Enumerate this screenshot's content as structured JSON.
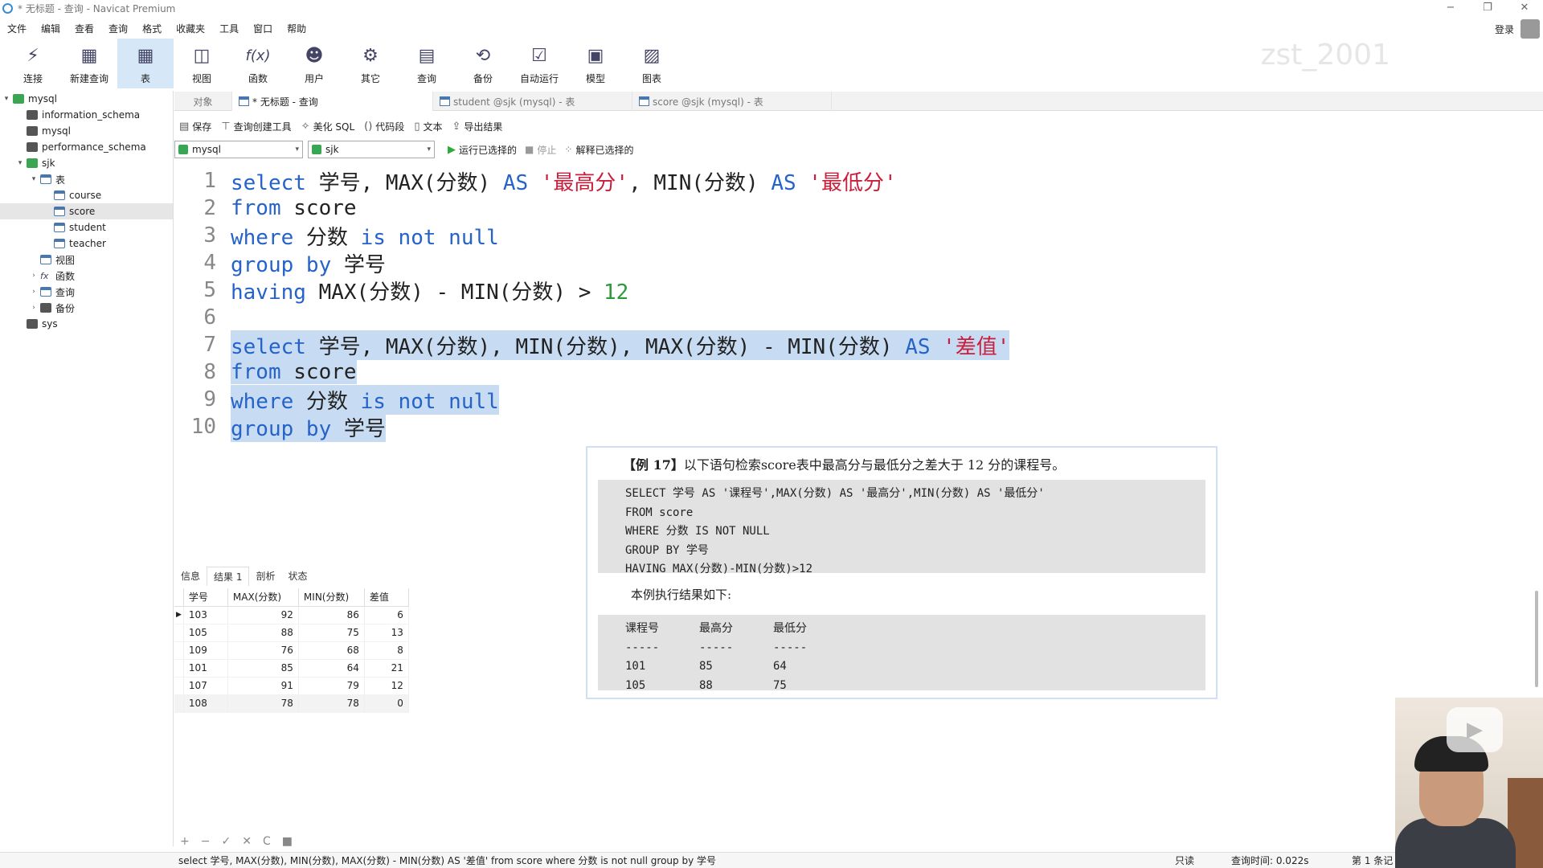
{
  "window": {
    "title": "* 无标题 - 查询 - Navicat Premium",
    "controls": [
      "−",
      "❐",
      "✕"
    ]
  },
  "menu": [
    "文件",
    "编辑",
    "查看",
    "查询",
    "格式",
    "收藏夹",
    "工具",
    "窗口",
    "帮助"
  ],
  "toolbar": {
    "buttons": [
      {
        "label": "连接",
        "icon": "plug-icon"
      },
      {
        "label": "新建查询",
        "icon": "new-query-icon"
      },
      {
        "label": "表",
        "icon": "table-icon",
        "active": true
      },
      {
        "label": "视图",
        "icon": "view-icon"
      },
      {
        "label": "函数",
        "icon": "function-icon",
        "glyph": "f(x)"
      },
      {
        "label": "用户",
        "icon": "user-icon"
      },
      {
        "label": "其它",
        "icon": "other-icon"
      },
      {
        "label": "查询",
        "icon": "query-icon"
      },
      {
        "label": "备份",
        "icon": "backup-icon"
      },
      {
        "label": "自动运行",
        "icon": "autorun-icon"
      },
      {
        "label": "模型",
        "icon": "model-icon"
      },
      {
        "label": "图表",
        "icon": "chart-icon"
      }
    ],
    "login": "登录",
    "watermark": "zst_2001"
  },
  "sidebar": {
    "items": [
      {
        "label": "mysql",
        "level": 0,
        "arrow": "▾",
        "icon": "connection-icon"
      },
      {
        "label": "information_schema",
        "level": 1,
        "arrow": "",
        "icon": "database-icon"
      },
      {
        "label": "mysql",
        "level": 1,
        "arrow": "",
        "icon": "database-icon"
      },
      {
        "label": "performance_schema",
        "level": 1,
        "arrow": "",
        "icon": "database-icon"
      },
      {
        "label": "sjk",
        "level": 1,
        "arrow": "▾",
        "icon": "database-open-icon"
      },
      {
        "label": "表",
        "level": 2,
        "arrow": "▾",
        "icon": "tables-folder-icon"
      },
      {
        "label": "course",
        "level": 3,
        "arrow": "",
        "icon": "table-icon"
      },
      {
        "label": "score",
        "level": 3,
        "arrow": "",
        "icon": "table-icon",
        "selected": true
      },
      {
        "label": "student",
        "level": 3,
        "arrow": "",
        "icon": "table-icon"
      },
      {
        "label": "teacher",
        "level": 3,
        "arrow": "",
        "icon": "table-icon"
      },
      {
        "label": "视图",
        "level": 2,
        "arrow": "",
        "icon": "view-icon"
      },
      {
        "label": "函数",
        "level": 2,
        "arrow": "›",
        "icon": "function-icon"
      },
      {
        "label": "查询",
        "level": 2,
        "arrow": "›",
        "icon": "query-icon"
      },
      {
        "label": "备份",
        "level": 2,
        "arrow": "›",
        "icon": "backup-icon"
      },
      {
        "label": "sys",
        "level": 1,
        "arrow": "",
        "icon": "database-icon"
      }
    ]
  },
  "tabs": [
    {
      "label": "对象",
      "active": false,
      "icon": false
    },
    {
      "label": "* 无标题 - 查询",
      "active": true,
      "icon": true
    },
    {
      "label": "student @sjk (mysql) - 表",
      "active": false,
      "icon": true
    },
    {
      "label": "score @sjk (mysql) - 表",
      "active": false,
      "icon": true
    }
  ],
  "query_toolbar": [
    {
      "label": "保存",
      "icon": "save-icon",
      "glyph": "▤"
    },
    {
      "label": "查询创建工具",
      "icon": "query-builder-icon",
      "glyph": "⊤"
    },
    {
      "label": "美化 SQL",
      "icon": "beautify-icon",
      "glyph": "✧"
    },
    {
      "label": "代码段",
      "icon": "snippet-icon",
      "glyph": "()"
    },
    {
      "label": "文本",
      "icon": "text-icon",
      "glyph": "▯"
    },
    {
      "label": "导出结果",
      "icon": "export-icon",
      "glyph": "⇪"
    }
  ],
  "selects": {
    "connection": "mysql",
    "database": "sjk",
    "run_selected": "运行已选择的",
    "stop": "停止",
    "explain": "解释已选择的"
  },
  "editor": {
    "lines": [
      {
        "n": "1",
        "hl": false,
        "tokens": [
          [
            "kw",
            "select"
          ],
          [
            "plain",
            " 学号, MAX(分数) "
          ],
          [
            "kw",
            "AS"
          ],
          [
            "plain",
            " "
          ],
          [
            "str",
            "'最高分'"
          ],
          [
            "plain",
            ", MIN(分数) "
          ],
          [
            "kw",
            "AS"
          ],
          [
            "plain",
            " "
          ],
          [
            "str",
            "'最低分'"
          ]
        ]
      },
      {
        "n": "2",
        "hl": false,
        "tokens": [
          [
            "kw",
            "from"
          ],
          [
            "plain",
            " score"
          ]
        ]
      },
      {
        "n": "3",
        "hl": false,
        "tokens": [
          [
            "kw",
            "where"
          ],
          [
            "plain",
            " 分数 "
          ],
          [
            "kw",
            "is not null"
          ]
        ]
      },
      {
        "n": "4",
        "hl": false,
        "tokens": [
          [
            "kw",
            "group by"
          ],
          [
            "plain",
            " 学号"
          ]
        ]
      },
      {
        "n": "5",
        "hl": false,
        "tokens": [
          [
            "kw",
            "having"
          ],
          [
            "plain",
            " MAX(分数) - MIN(分数) > "
          ],
          [
            "num",
            "12"
          ]
        ]
      },
      {
        "n": "6",
        "hl": false,
        "tokens": []
      },
      {
        "n": "7",
        "hl": true,
        "tokens": [
          [
            "kw",
            "select"
          ],
          [
            "plain",
            " 学号, MAX(分数), MIN(分数), MAX(分数) - MIN(分数) "
          ],
          [
            "kw",
            "AS"
          ],
          [
            "plain",
            " "
          ],
          [
            "str",
            "'差值'"
          ]
        ]
      },
      {
        "n": "8",
        "hl": true,
        "tokens": [
          [
            "kw",
            "from"
          ],
          [
            "plain",
            " score"
          ]
        ]
      },
      {
        "n": "9",
        "hl": true,
        "tokens": [
          [
            "kw",
            "where"
          ],
          [
            "plain",
            " 分数 "
          ],
          [
            "kw",
            "is not null"
          ]
        ]
      },
      {
        "n": "10",
        "hl": true,
        "tokens": [
          [
            "kw",
            "group by"
          ],
          [
            "plain",
            " 学号"
          ]
        ]
      }
    ]
  },
  "result_tabs": [
    "信息",
    "结果 1",
    "剖析",
    "状态"
  ],
  "result_grid": {
    "columns": [
      "学号",
      "MAX(分数)",
      "MIN(分数)",
      "差值"
    ],
    "rows": [
      [
        "103",
        "92",
        "86",
        "6"
      ],
      [
        "105",
        "88",
        "75",
        "13"
      ],
      [
        "109",
        "76",
        "68",
        "8"
      ],
      [
        "101",
        "85",
        "64",
        "21"
      ],
      [
        "107",
        "91",
        "79",
        "12"
      ],
      [
        "108",
        "78",
        "78",
        "0"
      ]
    ]
  },
  "overlay": {
    "title_bold": "【例 17】",
    "title_rest": "以下语句检索score表中最高分与最低分之差大于 12 分的课程号。",
    "code_lines": [
      "SELECT 学号 AS '课程号',MAX(分数) AS '最高分',MIN(分数) AS '最低分'",
      "FROM score",
      "WHERE 分数 IS NOT NULL",
      "GROUP BY 学号",
      "HAVING MAX(分数)-MIN(分数)>12"
    ],
    "middle_text": "本例执行结果如下:",
    "result_header": [
      "课程号",
      "最高分",
      "最低分"
    ],
    "result_sep": [
      "-----",
      "-----",
      "-----"
    ],
    "result_rows": [
      [
        "101",
        "85",
        "64"
      ],
      [
        "105",
        "88",
        "75"
      ]
    ]
  },
  "navbar": [
    "+",
    "−",
    "✓",
    "✕",
    "C",
    "■"
  ],
  "status": {
    "sql": "select 学号, MAX(分数), MIN(分数), MAX(分数) - MIN(分数) AS '差值' from score where 分数 is not null group by 学号",
    "readonly": "只读",
    "query_time": "查询时间: 0.022s",
    "page": "第 1 条记"
  }
}
